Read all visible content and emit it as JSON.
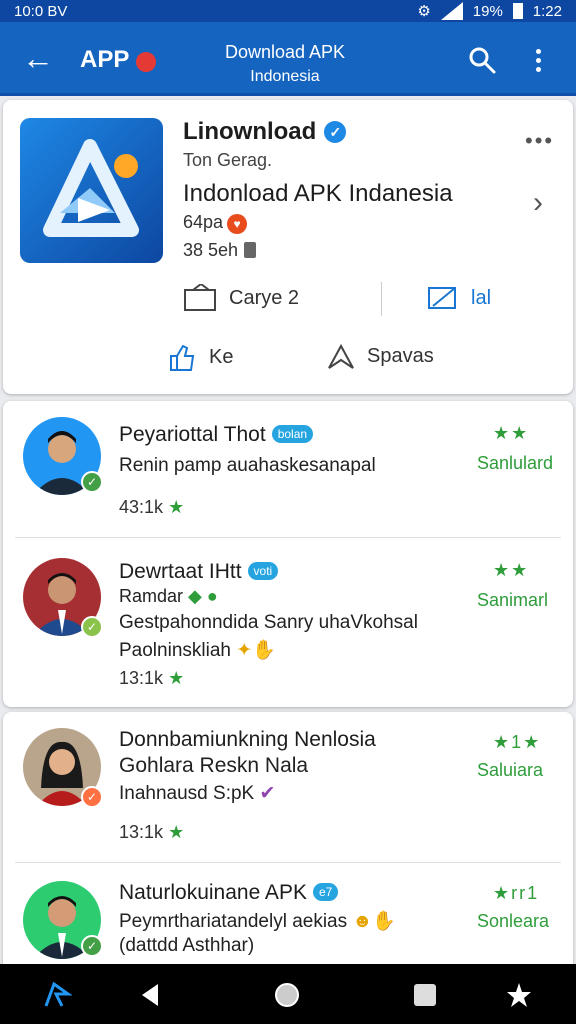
{
  "status": {
    "left": "10:0 BV",
    "battery": "19%",
    "time": "1:22"
  },
  "appbar": {
    "app_label": "APP",
    "title": "Download APK",
    "subtitle": "Indonesia"
  },
  "app": {
    "developer": "Linownload",
    "subtitle": "Ton Gerag.",
    "name": "Indonload APK Indanesia",
    "meta1": "64pa",
    "meta2": "38 5eh",
    "action_left": "Carye 2",
    "action_right": "lal",
    "action_k": "Ke",
    "action_s": "Spavas"
  },
  "items": [
    {
      "title": "Peyariottal Thot",
      "chip": "bolan",
      "line1": "Renin pamp auahaskesanapal",
      "line2": "",
      "count": "43:1k",
      "stars": "★★",
      "state": "Sanlulard"
    },
    {
      "title": "Dewrtaat IHtt",
      "chip": "voti",
      "line1": "Ramdar",
      "line2": "Gestpahonndida Sanry uhaVkohsal",
      "line3": "Paolninskliah",
      "count": "13:1k",
      "stars": "★★",
      "state": "Sanimarl"
    },
    {
      "title": "Donnbamiunkning Nenlosia",
      "chip": "",
      "line1": "Gohlara Reskn Nala",
      "line2": "Inahnausd S:pK",
      "count": "13:1k",
      "stars": "★1★",
      "state": "Saluiara"
    },
    {
      "title": "Naturlokuinane APK",
      "chip": "e7",
      "line1": "Peymrthariatandelyl aekias",
      "line2": "(dattdd Asthhar)",
      "count": "",
      "stars": "★rr1",
      "state": "Sonleara"
    }
  ],
  "colors": {
    "appbar": "#1565c0",
    "accent": "#1976d2",
    "green": "#2e9d3a"
  }
}
